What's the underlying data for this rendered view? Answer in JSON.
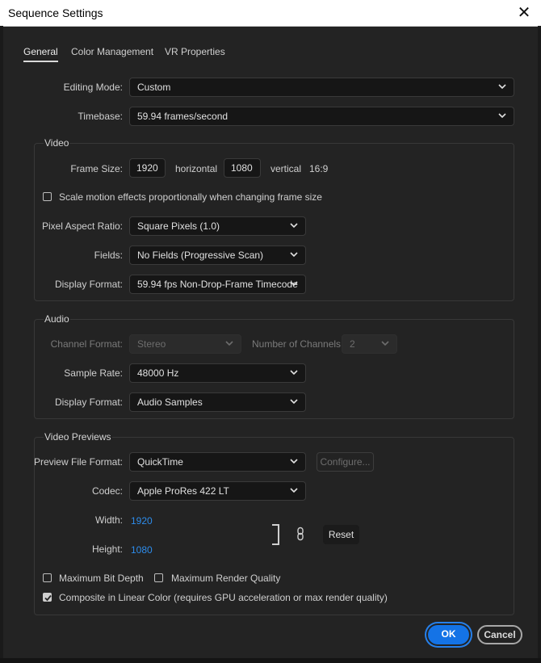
{
  "window": {
    "title": "Sequence Settings",
    "close_label": "✕"
  },
  "tabs": [
    {
      "label": "General",
      "active": true
    },
    {
      "label": "Color Management",
      "active": false
    },
    {
      "label": "VR Properties",
      "active": false
    }
  ],
  "general": {
    "editing_mode_label": "Editing Mode:",
    "editing_mode_value": "Custom",
    "timebase_label": "Timebase:",
    "timebase_value": "59.94  frames/second"
  },
  "video": {
    "group_title": "Video",
    "frame_size_label": "Frame Size:",
    "width_value": "1920",
    "horizontal_label": "horizontal",
    "height_value": "1080",
    "vertical_label": "vertical",
    "aspect_label": "16:9",
    "scale_motion_label": "Scale motion effects proportionally when changing frame size",
    "scale_motion_checked": false,
    "pixel_aspect_label": "Pixel Aspect Ratio:",
    "pixel_aspect_value": "Square Pixels (1.0)",
    "fields_label": "Fields:",
    "fields_value": "No Fields (Progressive Scan)",
    "display_format_label": "Display Format:",
    "display_format_value": "59.94 fps Non-Drop-Frame Timecode"
  },
  "audio": {
    "group_title": "Audio",
    "channel_format_label": "Channel Format:",
    "channel_format_value": "Stereo",
    "num_channels_label": "Number of Channels:",
    "num_channels_value": "2",
    "sample_rate_label": "Sample Rate:",
    "sample_rate_value": "48000 Hz",
    "display_format_label": "Display Format:",
    "display_format_value": "Audio Samples"
  },
  "previews": {
    "group_title": "Video Previews",
    "file_format_label": "Preview File Format:",
    "file_format_value": "QuickTime",
    "configure_label": "Configure...",
    "codec_label": "Codec:",
    "codec_value": "Apple ProRes 422 LT",
    "width_label": "Width:",
    "width_value": "1920",
    "height_label": "Height:",
    "height_value": "1080",
    "reset_label": "Reset",
    "max_bit_depth_label": "Maximum Bit Depth",
    "max_bit_depth_checked": false,
    "max_render_quality_label": "Maximum Render Quality",
    "max_render_quality_checked": false,
    "linear_color_label": "Composite in Linear Color (requires GPU acceleration or max render quality)",
    "linear_color_checked": true
  },
  "buttons": {
    "ok_label": "OK",
    "cancel_label": "Cancel"
  },
  "colors": {
    "accent": "#1473e6",
    "link": "#2d8ceb",
    "background": "#232323"
  }
}
